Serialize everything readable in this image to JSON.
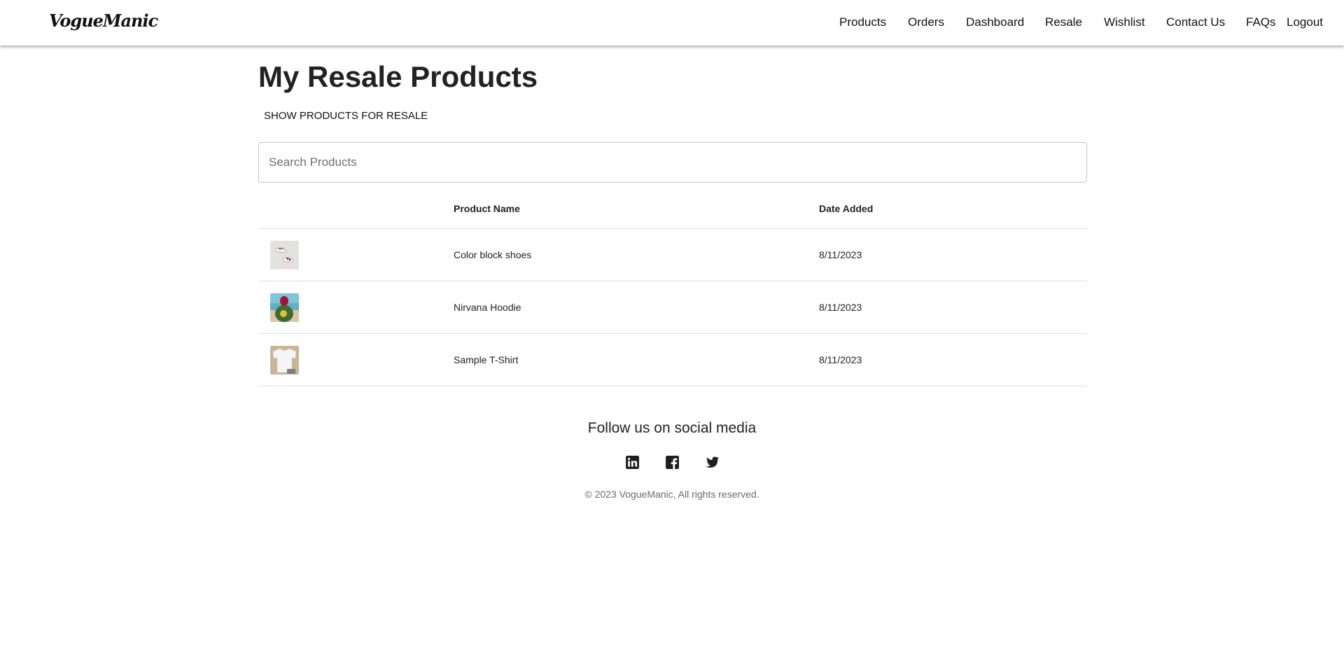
{
  "header": {
    "logo": "VogueManic",
    "nav": [
      "Products",
      "Orders",
      "Dashboard",
      "Resale",
      "Wishlist",
      "Contact Us",
      "FAQs",
      "Logout"
    ]
  },
  "main": {
    "title": "My Resale Products",
    "toggle_label": "SHOW PRODUCTS FOR RESALE",
    "search_placeholder": "Search Products",
    "table": {
      "columns": [
        "",
        "Product Name",
        "Date Added"
      ],
      "rows": [
        {
          "name": "Color block shoes",
          "date": "8/11/2023",
          "thumb": "shoes-thumbnail"
        },
        {
          "name": "Nirvana Hoodie",
          "date": "8/11/2023",
          "thumb": "hoodie-thumbnail"
        },
        {
          "name": "Sample T-Shirt",
          "date": "8/11/2023",
          "thumb": "tshirt-thumbnail"
        }
      ]
    }
  },
  "footer": {
    "follow_text": "Follow us on social media",
    "socials": [
      "linkedin-icon",
      "facebook-icon",
      "twitter-icon"
    ],
    "copyright": "© 2023 VogueManic, All rights reserved."
  }
}
